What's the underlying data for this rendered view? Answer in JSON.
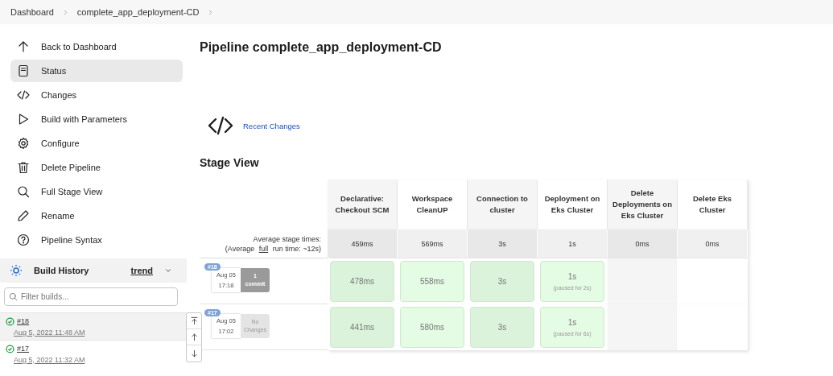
{
  "breadcrumbs": [
    "Dashboard",
    "complete_app_deployment-CD"
  ],
  "sidebar": {
    "items": [
      {
        "label": "Back to Dashboard",
        "selected": false
      },
      {
        "label": "Status",
        "selected": true
      },
      {
        "label": "Changes",
        "selected": false
      },
      {
        "label": "Build with Parameters",
        "selected": false
      },
      {
        "label": "Configure",
        "selected": false
      },
      {
        "label": "Delete Pipeline",
        "selected": false
      },
      {
        "label": "Full Stage View",
        "selected": false
      },
      {
        "label": "Rename",
        "selected": false
      },
      {
        "label": "Pipeline Syntax",
        "selected": false
      }
    ]
  },
  "build_history": {
    "title": "Build History",
    "trend": "trend",
    "filter": {
      "placeholder": "Filter builds..."
    },
    "builds": [
      {
        "number": "#18",
        "date": "Aug 5, 2022 11:48 AM",
        "selected": true
      },
      {
        "number": "#17",
        "date": "Aug 5, 2022 11:32 AM",
        "selected": false
      }
    ]
  },
  "title": "Pipeline complete_app_deployment-CD",
  "recent_changes": "Recent Changes",
  "stage_view": {
    "title": "Stage View",
    "stages": [
      "Declarative: Checkout SCM",
      "Workspace CleanUP",
      "Connection to cluster",
      "Deployment on Eks Cluster",
      "Delete Deployments on Eks Cluster",
      "Delete Eks Cluster"
    ],
    "average_label": "Average stage times:",
    "run_prefix": "(Average",
    "run_link": "full",
    "run_suffix": "run time: ~12s)",
    "averages": [
      "459ms",
      "569ms",
      "3s",
      "1s",
      "0ms",
      "0ms"
    ],
    "builds": [
      {
        "badge": "#18",
        "date": "Aug 05",
        "time": "17:18",
        "changes": "1 commit",
        "kind": "commits",
        "cells": [
          {
            "kind": "success",
            "time": "478ms"
          },
          {
            "kind": "success",
            "time": "558ms"
          },
          {
            "kind": "success",
            "time": "3s"
          },
          {
            "kind": "success",
            "time": "1s",
            "note": "(paused for 2s)"
          },
          {
            "kind": "empty"
          },
          {
            "kind": "empty"
          }
        ]
      },
      {
        "badge": "#17",
        "date": "Aug 05",
        "time": "17:02",
        "changes": "No Changes",
        "kind": "none",
        "cells": [
          {
            "kind": "success",
            "time": "441ms"
          },
          {
            "kind": "success",
            "time": "580ms"
          },
          {
            "kind": "success",
            "time": "3s"
          },
          {
            "kind": "success",
            "time": "1s",
            "note": "(paused for 6s)"
          },
          {
            "kind": "empty"
          },
          {
            "kind": "empty"
          }
        ]
      }
    ]
  }
}
